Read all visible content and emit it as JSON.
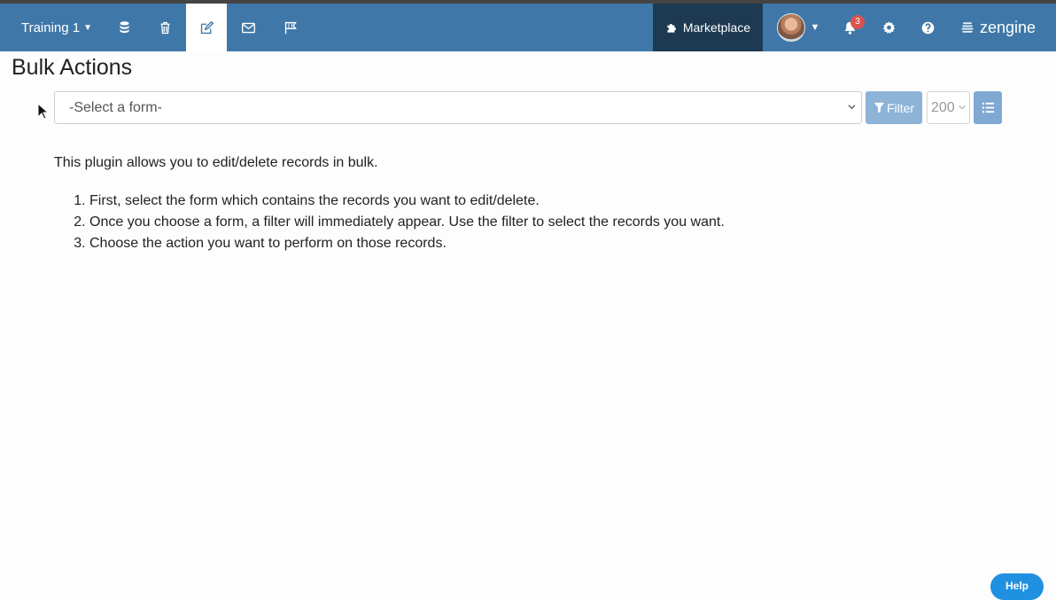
{
  "navbar": {
    "workspace": "Training 1",
    "marketplace_label": "Marketplace",
    "notification_count": "3",
    "brand": "zengine",
    "icons": [
      "database-icon",
      "trash-icon",
      "edit-icon",
      "mail-icon",
      "flag-icon",
      "puzzle-icon",
      "avatar",
      "bell-icon",
      "gear-icon",
      "question-icon",
      "zengine-logo-icon"
    ],
    "colors": {
      "bar": "#3f78a8",
      "marketplace_bg": "#1e3a52",
      "badge": "#d9534f"
    }
  },
  "page": {
    "title": "Bulk Actions"
  },
  "controls": {
    "form_select_placeholder": "-Select a form-",
    "filter_label": "Filter",
    "limit_value": "200"
  },
  "content": {
    "intro": "This plugin allows you to edit/delete records in bulk.",
    "steps": [
      "First, select the form which contains the records you want to edit/delete.",
      "Once you choose a form, a filter will immediately appear. Use the filter to select the records you want.",
      "Choose the action you want to perform on those records."
    ]
  },
  "help_widget": {
    "label": "Help",
    "color": "#1f91e0"
  }
}
